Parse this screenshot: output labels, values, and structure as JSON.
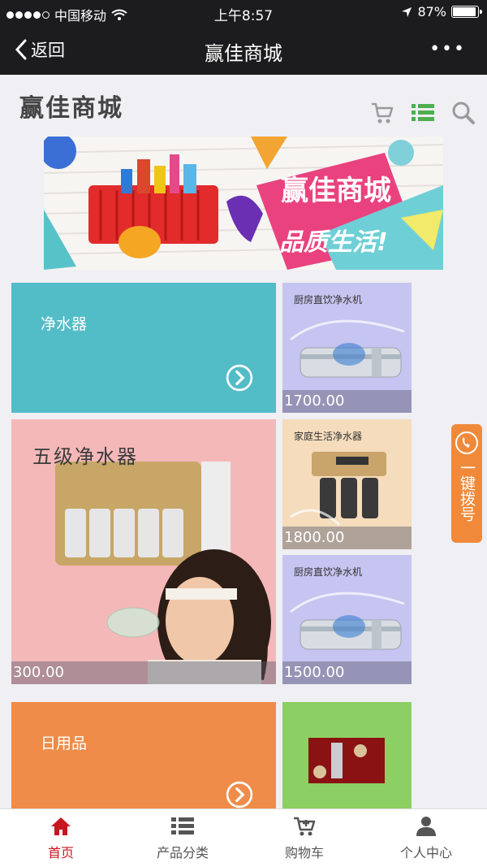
{
  "status": {
    "carrier": "中国移动",
    "time": "上午8:57",
    "battery": "87%",
    "battery_level": 0.87
  },
  "nav": {
    "back_label": "返回",
    "title": "赢佳商城",
    "more": "•••"
  },
  "header": {
    "title": "赢佳商城"
  },
  "banner": {
    "title": "赢佳商城",
    "slogan": "品质生活!"
  },
  "grid": {
    "cat1": {
      "label": "净水器"
    },
    "cat2": {
      "label": "日用品"
    },
    "big_product": {
      "caption": "五级净水器",
      "price": "300.00"
    },
    "products": [
      {
        "name": "厨房直饮净水机",
        "price": "1700.00"
      },
      {
        "name": "家庭生活净水器",
        "price": "1800.00"
      },
      {
        "name": "厨房直饮净水机",
        "price": "1500.00"
      }
    ]
  },
  "call_button": {
    "label": "一键拨号"
  },
  "tabbar": [
    {
      "label": "首页",
      "icon": "home-icon"
    },
    {
      "label": "产品分类",
      "icon": "list-icon"
    },
    {
      "label": "购物车",
      "icon": "cart-icon"
    },
    {
      "label": "个人中心",
      "icon": "user-icon"
    }
  ],
  "colors": {
    "accent": "#c8161e",
    "teal": "#52bcc7",
    "orange": "#ef8c49",
    "green": "#8ccf62"
  }
}
